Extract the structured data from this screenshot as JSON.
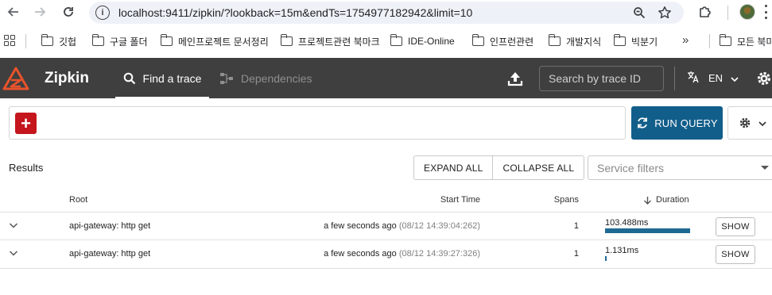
{
  "browser": {
    "url": "localhost:9411/zipkin/?lookback=15m&endTs=1754977182942&limit=10",
    "bookmarks": [
      "깃헙",
      "구글 폴더",
      "메인프로젝트 문서정리",
      "프로젝트관련 북마크",
      "IDE-Online",
      "인프런관련",
      "개발지식",
      "빅분기",
      "모든 북마"
    ],
    "more_label": "»"
  },
  "header": {
    "brand": "Zipkin",
    "tabs": [
      {
        "label": "Find a trace",
        "active": true
      },
      {
        "label": "Dependencies",
        "active": false
      }
    ],
    "search_placeholder": "Search by trace ID",
    "language": "EN"
  },
  "query": {
    "add_label": "+",
    "run_label": "RUN QUERY"
  },
  "results": {
    "label": "Results",
    "expand_all": "EXPAND ALL",
    "collapse_all": "COLLAPSE ALL",
    "service_filter_placeholder": "Service filters",
    "columns": {
      "root": "Root",
      "start_time": "Start Time",
      "spans": "Spans",
      "duration": "Duration"
    },
    "rows": [
      {
        "root": "api-gateway: http get",
        "relative": "a few seconds ago",
        "timestamp": "(08/12 14:39:04:262)",
        "spans": "1",
        "duration": "103.488ms",
        "duration_fraction": 1.0,
        "show_label": "SHOW"
      },
      {
        "root": "api-gateway: http get",
        "relative": "a few seconds ago",
        "timestamp": "(08/12 14:39:27:326)",
        "spans": "1",
        "duration": "1.131ms",
        "duration_fraction": 0.011,
        "show_label": "SHOW"
      }
    ]
  },
  "colors": {
    "header_bg": "#3f3f3f",
    "accent_red": "#c4161c",
    "run_query_blue": "#125e8a",
    "duration_bar": "#1f6a93"
  }
}
